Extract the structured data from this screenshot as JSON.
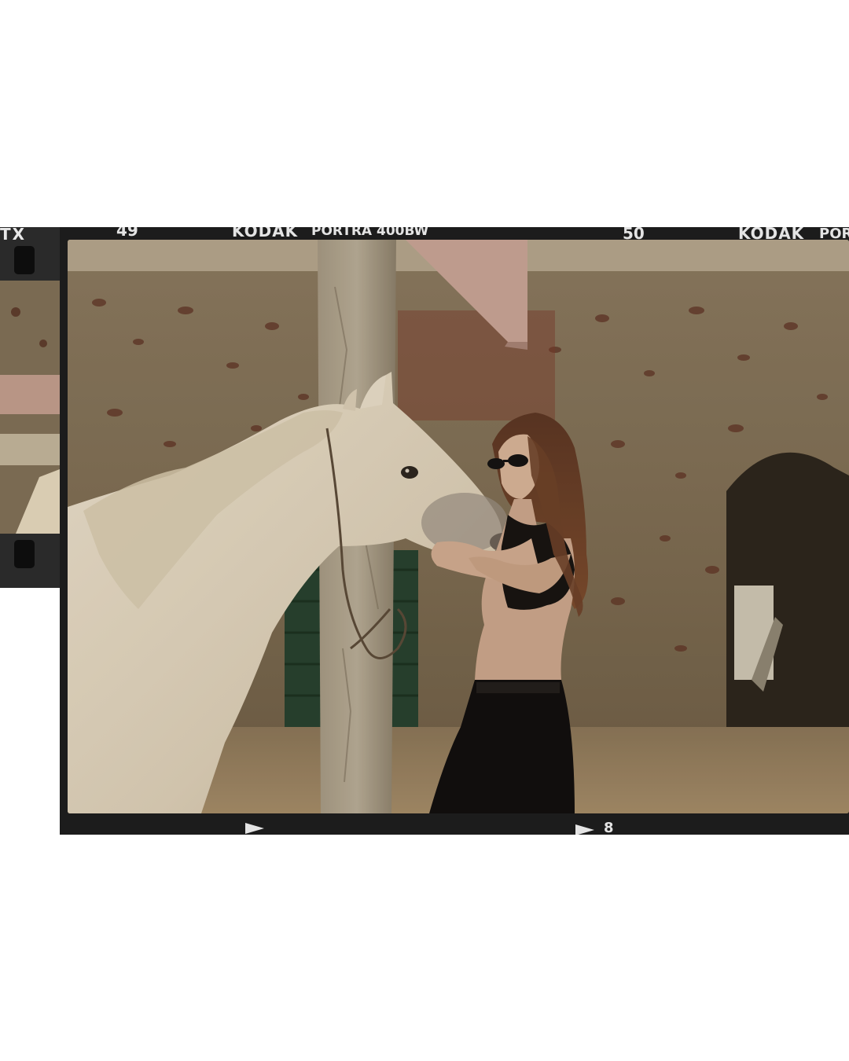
{
  "film": {
    "left_edge_code": "TX",
    "frame_number_left": "49",
    "brand_left": "KODAK",
    "stock_left": "PORTRA 400BW",
    "frame_number_right": "50",
    "brand_right": "KODAK",
    "stock_right_partial": "POR",
    "bottom_frame_index": "8"
  },
  "colors": {
    "film_base": "#1c1c1c",
    "edge_print": "#e4e4e4",
    "background": "#ffffff"
  }
}
